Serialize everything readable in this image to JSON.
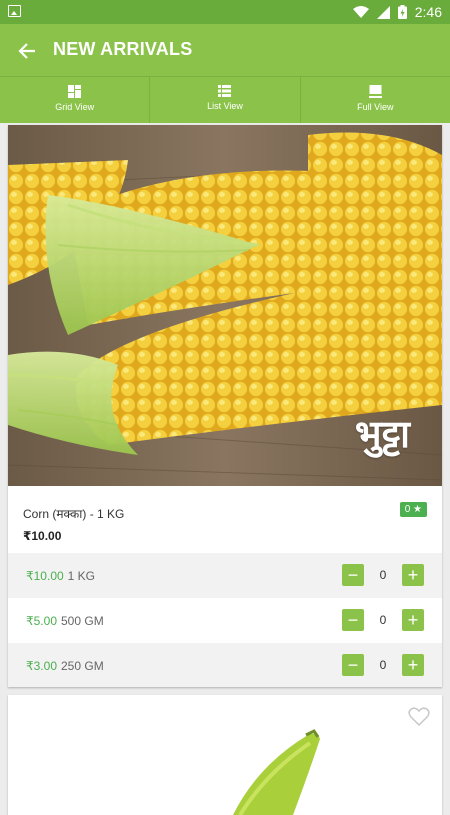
{
  "status_bar": {
    "time": "2:46"
  },
  "app_bar": {
    "title": "NEW ARRIVALS"
  },
  "view_tabs": [
    {
      "label": "Grid View",
      "icon": "grid-icon"
    },
    {
      "label": "List View",
      "icon": "list-icon"
    },
    {
      "label": "Full View",
      "icon": "full-view-icon"
    }
  ],
  "products": [
    {
      "image_caption": "भुट्टा",
      "name": "Corn (मक्का) - 1 KG",
      "rating": "0 ★",
      "price": "₹10.00",
      "variants": [
        {
          "price": "₹10.00",
          "unit": "1 KG",
          "qty": "0"
        },
        {
          "price": "₹5.00",
          "unit": "500 GM",
          "qty": "0"
        },
        {
          "price": "₹3.00",
          "unit": "250 GM",
          "qty": "0"
        }
      ]
    }
  ],
  "stepper": {
    "minus": "−",
    "plus": "+"
  },
  "colors": {
    "primary": "#8bc34a",
    "status_bar": "#69ac3b",
    "price_green": "#4caf50"
  }
}
